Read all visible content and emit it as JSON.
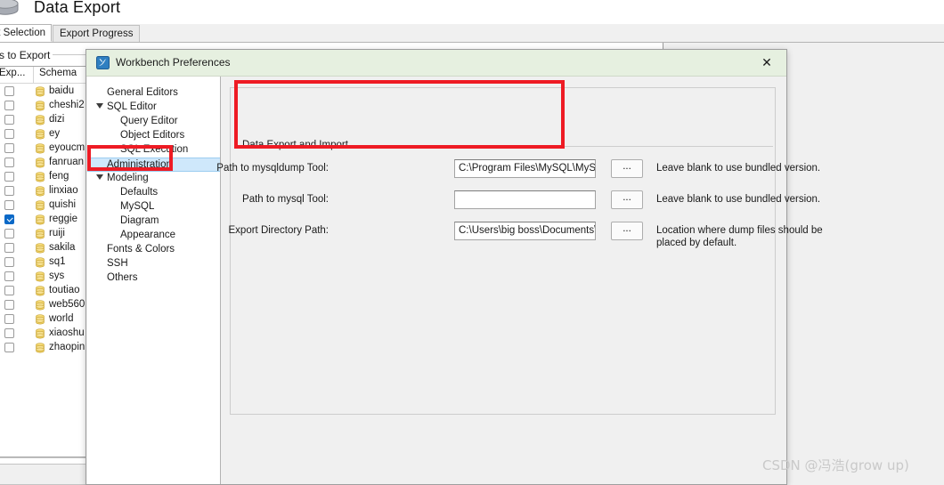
{
  "app": {
    "wizard_title": "Data Export",
    "db_icon": "database-cylinder-icon",
    "tabs": [
      {
        "label": "ct Selection",
        "active": true
      },
      {
        "label": "Export Progress",
        "active": false
      }
    ],
    "tables_group_label": "bles to Export",
    "schema_list": {
      "columns": [
        "Exp...",
        "Schema"
      ],
      "rows": [
        {
          "name": "baidu",
          "checked": false
        },
        {
          "name": "cheshi2",
          "checked": false
        },
        {
          "name": "dizi",
          "checked": false
        },
        {
          "name": "ey",
          "checked": false
        },
        {
          "name": "eyoucm",
          "checked": false
        },
        {
          "name": "fanruan",
          "checked": false
        },
        {
          "name": "feng",
          "checked": false
        },
        {
          "name": "linxiao",
          "checked": false
        },
        {
          "name": "quishi",
          "checked": false
        },
        {
          "name": "reggie",
          "checked": true
        },
        {
          "name": "ruiji",
          "checked": false
        },
        {
          "name": "sakila",
          "checked": false
        },
        {
          "name": "sq1",
          "checked": false
        },
        {
          "name": "sys",
          "checked": false
        },
        {
          "name": "toutiao",
          "checked": false
        },
        {
          "name": "web560",
          "checked": false
        },
        {
          "name": "world",
          "checked": false
        },
        {
          "name": "xiaoshu",
          "checked": false
        },
        {
          "name": "zhaopin",
          "checked": false
        }
      ]
    }
  },
  "dialog": {
    "title": "Workbench Preferences",
    "app_icon": "workbench-dolphin-icon",
    "close_label": "✕",
    "nav": [
      {
        "label": "General Editors",
        "level": 0,
        "twisty": false,
        "selected": false
      },
      {
        "label": "SQL Editor",
        "level": 0,
        "twisty": true,
        "selected": false
      },
      {
        "label": "Query Editor",
        "level": 1,
        "twisty": false,
        "selected": false
      },
      {
        "label": "Object Editors",
        "level": 1,
        "twisty": false,
        "selected": false
      },
      {
        "label": "SQL Execution",
        "level": 1,
        "twisty": false,
        "selected": false
      },
      {
        "label": "Administration",
        "level": 0,
        "twisty": false,
        "selected": true
      },
      {
        "label": "Modeling",
        "level": 0,
        "twisty": true,
        "selected": false
      },
      {
        "label": "Defaults",
        "level": 1,
        "twisty": false,
        "selected": false
      },
      {
        "label": "MySQL",
        "level": 1,
        "twisty": false,
        "selected": false
      },
      {
        "label": "Diagram",
        "level": 1,
        "twisty": false,
        "selected": false
      },
      {
        "label": "Appearance",
        "level": 1,
        "twisty": false,
        "selected": false
      },
      {
        "label": "Fonts & Colors",
        "level": 0,
        "twisty": false,
        "selected": false
      },
      {
        "label": "SSH",
        "level": 0,
        "twisty": false,
        "selected": false
      },
      {
        "label": "Others",
        "level": 0,
        "twisty": false,
        "selected": false
      }
    ],
    "group_legend": "Data Export and Import",
    "browse_label": "...",
    "fields": [
      {
        "label": "Path to mysqldump Tool:",
        "value": "C:\\Program Files\\MySQL\\MySQL S",
        "hint": "Leave blank to use bundled version."
      },
      {
        "label": "Path to mysql Tool:",
        "value": "",
        "hint": "Leave blank to use bundled version."
      },
      {
        "label": "Export Directory Path:",
        "value": "C:\\Users\\big boss\\Documents\\dum",
        "hint": "Location where dump files should be placed by default."
      }
    ]
  },
  "annotations": {
    "accent_color": "#ee1b24",
    "boxes": [
      {
        "name": "data-export-and-import-highlight"
      },
      {
        "name": "administration-nav-highlight"
      }
    ]
  },
  "watermark": {
    "text": "CSDN @冯浩(grow up)"
  }
}
